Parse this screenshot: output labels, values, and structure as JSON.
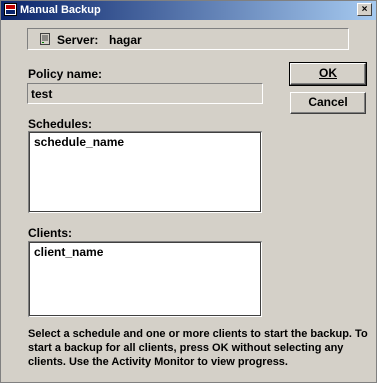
{
  "window": {
    "title": "Manual Backup",
    "close_label": "×"
  },
  "server": {
    "label": "Server:",
    "value": "hagar",
    "icon": "server-icon"
  },
  "policy": {
    "label": "Policy name:",
    "value": "test"
  },
  "schedules": {
    "label": "Schedules:",
    "column_header": "schedule_name",
    "items": []
  },
  "clients": {
    "label": "Clients:",
    "column_header": "client_name",
    "items": []
  },
  "buttons": {
    "ok": "OK",
    "cancel": "Cancel"
  },
  "help_text": "Select a schedule and one or more clients to start the backup. To start a backup for all clients, press OK without selecting any clients. Use the Activity Monitor to view progress."
}
